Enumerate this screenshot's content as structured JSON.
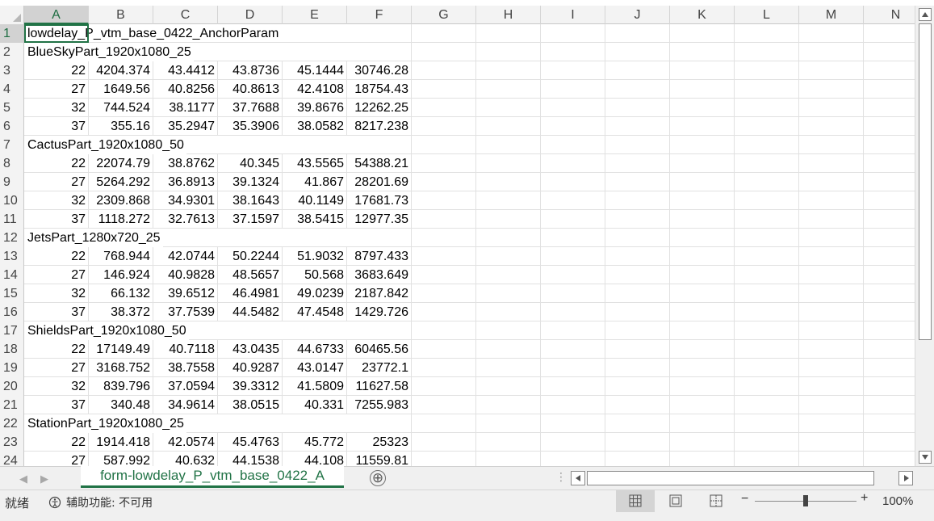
{
  "columns": [
    "A",
    "B",
    "C",
    "D",
    "E",
    "F",
    "G",
    "H",
    "I",
    "J",
    "K",
    "L",
    "M",
    "N"
  ],
  "selected_column": "A",
  "selected_row": "1",
  "rows": [
    {
      "n": "1",
      "title": "lowdelay_P_vtm_base_0422_AnchorParam"
    },
    {
      "n": "2",
      "title": "BlueSkyPart_1920x1080_25"
    },
    {
      "n": "3",
      "cells": [
        "22",
        "4204.374",
        "43.4412",
        "43.8736",
        "45.1444",
        "30746.28"
      ]
    },
    {
      "n": "4",
      "cells": [
        "27",
        "1649.56",
        "40.8256",
        "40.8613",
        "42.4108",
        "18754.43"
      ]
    },
    {
      "n": "5",
      "cells": [
        "32",
        "744.524",
        "38.1177",
        "37.7688",
        "39.8676",
        "12262.25"
      ]
    },
    {
      "n": "6",
      "cells": [
        "37",
        "355.16",
        "35.2947",
        "35.3906",
        "38.0582",
        "8217.238"
      ]
    },
    {
      "n": "7",
      "title": "CactusPart_1920x1080_50"
    },
    {
      "n": "8",
      "cells": [
        "22",
        "22074.79",
        "38.8762",
        "40.345",
        "43.5565",
        "54388.21"
      ]
    },
    {
      "n": "9",
      "cells": [
        "27",
        "5264.292",
        "36.8913",
        "39.1324",
        "41.867",
        "28201.69"
      ]
    },
    {
      "n": "10",
      "cells": [
        "32",
        "2309.868",
        "34.9301",
        "38.1643",
        "40.1149",
        "17681.73"
      ]
    },
    {
      "n": "11",
      "cells": [
        "37",
        "1118.272",
        "32.7613",
        "37.1597",
        "38.5415",
        "12977.35"
      ]
    },
    {
      "n": "12",
      "title": "JetsPart_1280x720_25"
    },
    {
      "n": "13",
      "cells": [
        "22",
        "768.944",
        "42.0744",
        "50.2244",
        "51.9032",
        "8797.433"
      ]
    },
    {
      "n": "14",
      "cells": [
        "27",
        "146.924",
        "40.9828",
        "48.5657",
        "50.568",
        "3683.649"
      ]
    },
    {
      "n": "15",
      "cells": [
        "32",
        "66.132",
        "39.6512",
        "46.4981",
        "49.0239",
        "2187.842"
      ]
    },
    {
      "n": "16",
      "cells": [
        "37",
        "38.372",
        "37.7539",
        "44.5482",
        "47.4548",
        "1429.726"
      ]
    },
    {
      "n": "17",
      "title": "ShieldsPart_1920x1080_50"
    },
    {
      "n": "18",
      "cells": [
        "22",
        "17149.49",
        "40.7118",
        "43.0435",
        "44.6733",
        "60465.56"
      ]
    },
    {
      "n": "19",
      "cells": [
        "27",
        "3168.752",
        "38.7558",
        "40.9287",
        "43.0147",
        "23772.1"
      ]
    },
    {
      "n": "20",
      "cells": [
        "32",
        "839.796",
        "37.0594",
        "39.3312",
        "41.5809",
        "11627.58"
      ]
    },
    {
      "n": "21",
      "cells": [
        "37",
        "340.48",
        "34.9614",
        "38.0515",
        "40.331",
        "7255.983"
      ]
    },
    {
      "n": "22",
      "title": "StationPart_1920x1080_25"
    },
    {
      "n": "23",
      "cells": [
        "22",
        "1914.418",
        "42.0574",
        "45.4763",
        "45.772",
        "25323"
      ]
    },
    {
      "n": "24",
      "cells": [
        "27",
        "587.992",
        "40.632",
        "44.1538",
        "44.108",
        "11559.81"
      ]
    }
  ],
  "sheet_tab": {
    "label": "form-lowdelay_P_vtm_base_0422_A",
    "add_label": "⊕"
  },
  "status": {
    "ready": "就绪",
    "accessibility": "辅助功能: 不可用",
    "zoom_minus": "−",
    "zoom_plus": "+",
    "zoom": "100%"
  },
  "colors": {
    "accent": "#217346"
  }
}
